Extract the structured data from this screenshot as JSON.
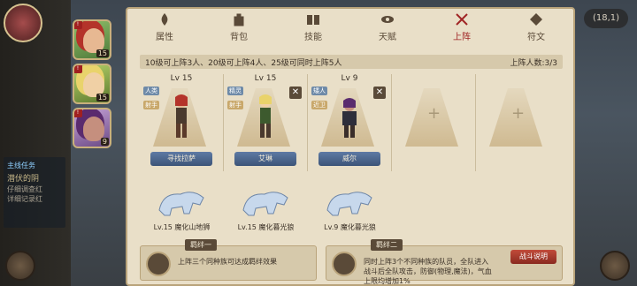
{
  "coord": "(18,1)",
  "quest": {
    "title": "主线任务",
    "line": "潜伏的阴",
    "sub": "仔细调查红\n详细记录红"
  },
  "portraits": [
    {
      "level": "15"
    },
    {
      "level": "15"
    },
    {
      "level": "9"
    }
  ],
  "tabs": [
    {
      "label": "属性"
    },
    {
      "label": "背包"
    },
    {
      "label": "技能"
    },
    {
      "label": "天赋"
    },
    {
      "label": "上阵"
    },
    {
      "label": "符文"
    }
  ],
  "rule": {
    "text": "10级可上阵3人、20级可上阵4人、25级可同时上阵5人",
    "count": "上阵人数:3/3"
  },
  "slots": [
    {
      "lv": "Lv 15",
      "tag1": "人类",
      "tag2": "射手",
      "name": "寻找拉萨"
    },
    {
      "lv": "Lv 15",
      "tag1": "精灵",
      "tag2": "射手",
      "name": "艾琳"
    },
    {
      "lv": "Lv 9",
      "tag1": "矮人",
      "tag2": "近卫",
      "name": "威尔"
    }
  ],
  "beasts": [
    {
      "label": "Lv.15 魔化山地狮"
    },
    {
      "label": "Lv.15 魔化暮光狼"
    },
    {
      "label": "Lv.9 魔化暮光狼"
    }
  ],
  "bond1": {
    "title": "羁绊一",
    "text": "上阵三个同种族可达成羁绊效果"
  },
  "bond2": {
    "title": "羁绊二",
    "text": "同时上阵3个不同种族的队员，全队进入\n战斗后全队攻击，防御(物理,魔法)，气血\n上限均增加1%"
  },
  "battle_button": "战斗说明"
}
